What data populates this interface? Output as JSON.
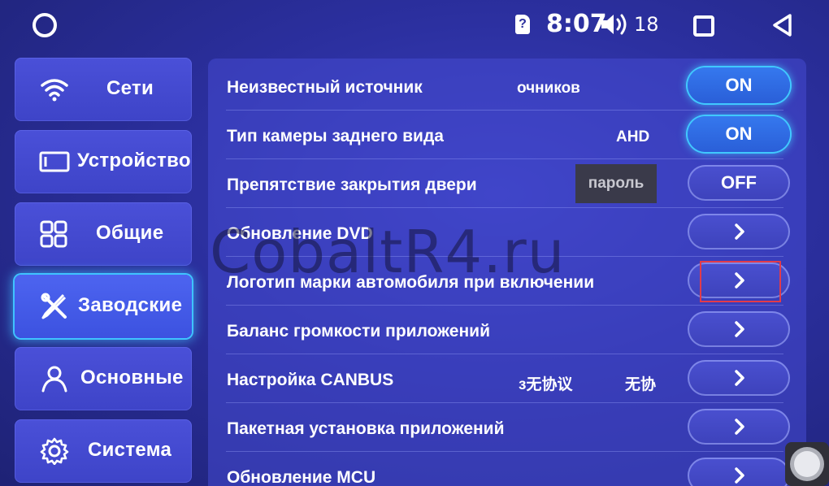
{
  "status_bar": {
    "time": "8:07",
    "sim_glyph": "?",
    "volume": "18",
    "icons": [
      "home-circle-icon",
      "sim-unknown-icon",
      "volume-icon",
      "recent-apps-icon",
      "back-icon"
    ]
  },
  "sidebar": {
    "items": [
      {
        "label": "Сети",
        "icon": "wifi-icon"
      },
      {
        "label": "Устройство",
        "icon": "screen-icon"
      },
      {
        "label": "Общие",
        "icon": "grid-icon"
      },
      {
        "label": "Заводские",
        "icon": "tools-icon",
        "active": true
      },
      {
        "label": "Основные",
        "icon": "user-icon"
      },
      {
        "label": "Система",
        "icon": "gear-icon"
      }
    ]
  },
  "settings": {
    "rows": [
      {
        "label": "Неизвестный источник",
        "extra": "очников",
        "control": "ON"
      },
      {
        "label": "Тип камеры заднего вида",
        "extra": "AHD",
        "control": "ON"
      },
      {
        "label": "Препятствие закрытия двери",
        "overlay": "пароль",
        "control": "OFF"
      },
      {
        "label": "Обновление DVD",
        "control": "chevron"
      },
      {
        "label": "Логотип марки автомобиля при включении",
        "control": "chevron"
      },
      {
        "label": "Баланс громкости приложений",
        "control": "chevron"
      },
      {
        "label": "Настройка CANBUS",
        "extra": "з无协议",
        "extra2": "无协",
        "control": "chevron"
      },
      {
        "label": "Пакетная установка приложений",
        "control": "chevron"
      },
      {
        "label": "Обновление MCU",
        "control": "chevron"
      }
    ]
  },
  "watermark": "CobaltR4.ru",
  "colors": {
    "background": "#2b2f9e",
    "accent_glow": "#40c8ff",
    "highlight_box": "#e23b4a"
  }
}
